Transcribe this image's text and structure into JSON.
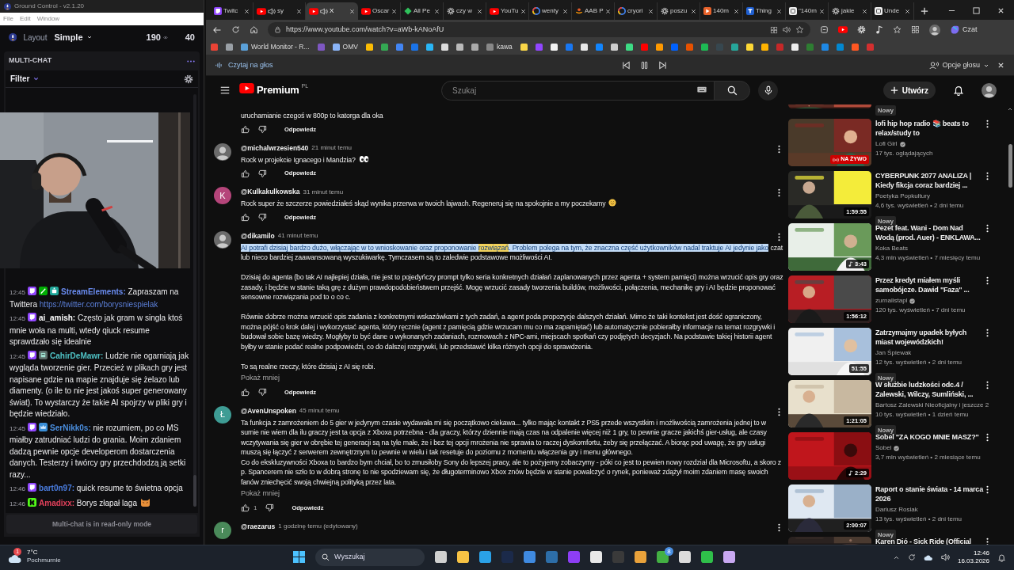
{
  "app": {
    "title": "Ground Control - v2.1.20",
    "menu": [
      "File",
      "Edit",
      "Window"
    ],
    "layout_label": "Layout",
    "layout_value": "Simple",
    "viewers": "190",
    "followers": "40",
    "panel_title": "MULTI-CHAT",
    "filter": "Filter",
    "footer": "Multi-chat is in read-only mode"
  },
  "chat": [
    {
      "time": "12:45",
      "user": "StreamElements:",
      "color": "#6a8cf0",
      "text": "Zapraszam na Twittera",
      "link": "https://twitter.com/borysniespielak"
    },
    {
      "time": "12:45",
      "user": "ai_amish:",
      "color": "#ffffff",
      "text": "Często jak gram w singla ktoś mnie woła na multi, wtedy qiuck resume sprawdzało się idealnie"
    },
    {
      "time": "12:45",
      "user": "CahirDeMawr:",
      "color": "#4fc1c4",
      "text": "Ludzie nie ogarniają jak wygląda tworzenie gier. Przecież w plikach gry jest napisane gdzie na mapie znajduje się żelazo lub diamenty. (o ile to nie jest jakoś super generowany świat). To wystarczy że takie AI spojrzy w pliki gry i będzie wiedziało."
    },
    {
      "time": "12:45",
      "user": "SerNikk0s:",
      "color": "#4b8fe0",
      "text": "nie rozumiem, po co MS miałby zatrudniać ludzi do grania. Moim zdaniem dadzą pewnie opcje developerom dostarczenia danych. Testerzy i twórcy gry przechdodzą ją setki razy..."
    },
    {
      "time": "12:46",
      "user": "bart0n97:",
      "color": "#4a7de0",
      "text": "quick resume to świetna opcja"
    },
    {
      "time": "12:46",
      "user": "Amadixx:",
      "color": "#e0405a",
      "text": "Borys złapał laga",
      "emote": true
    }
  ],
  "browser": {
    "tabs": [
      {
        "title": "Twitc",
        "audio": false,
        "selected": false
      },
      {
        "title": "sy",
        "audio": true,
        "selected": false
      },
      {
        "title": "X",
        "audio": true,
        "selected": true
      },
      {
        "title": "Oscar",
        "audio": false,
        "selected": false
      },
      {
        "title": "All Pe",
        "audio": false,
        "selected": false
      },
      {
        "title": "czy w",
        "audio": false,
        "selected": false
      },
      {
        "title": "YouTu",
        "audio": false,
        "selected": false
      },
      {
        "title": "wenty",
        "audio": false,
        "selected": false
      },
      {
        "title": "AAB P",
        "audio": false,
        "selected": false
      },
      {
        "title": "cryori",
        "audio": false,
        "selected": false
      },
      {
        "title": "poszu",
        "audio": false,
        "selected": false
      },
      {
        "title": "140m",
        "audio": false,
        "selected": false
      },
      {
        "title": "Thing",
        "audio": false,
        "selected": false
      },
      {
        "title": "\"140m",
        "audio": false,
        "selected": false
      },
      {
        "title": "jakie",
        "audio": false,
        "selected": false
      },
      {
        "title": "Unde",
        "audio": false,
        "selected": false
      }
    ],
    "url": "https://www.youtube.com/watch?v=aWb-kANoAfU",
    "copilot": "Czat",
    "bookmarks": [
      {
        "color": "#ea4335"
      },
      {
        "color": "#9aa0a6"
      },
      {
        "label": "World Monitor - R...",
        "color": "#5aa0d8"
      },
      {
        "color": "#7e57c2"
      },
      {
        "label": "OMV",
        "color": "#8ab4f8"
      },
      {
        "color": "#fbbc04"
      },
      {
        "color": "#34a853"
      },
      {
        "color": "#4285f4"
      },
      {
        "color": "#1a73e8"
      },
      {
        "color": "#29b6f6"
      },
      {
        "color": "#dddddd"
      },
      {
        "color": "#bbbbbb"
      },
      {
        "color": "#aaaaaa"
      },
      {
        "label": "kawa",
        "color": "#888888"
      },
      {
        "color": "#f9d648"
      },
      {
        "color": "#9146ff"
      },
      {
        "color": "#f2f2f2"
      },
      {
        "color": "#1877f2"
      },
      {
        "color": "#e8e8e8"
      },
      {
        "color": "#1185fe"
      },
      {
        "color": "#cfcfcf"
      },
      {
        "color": "#3ddc84"
      },
      {
        "color": "#ff0000"
      },
      {
        "color": "#ff9900"
      },
      {
        "color": "#0061fe"
      },
      {
        "color": "#e65100"
      },
      {
        "color": "#1db954"
      },
      {
        "color": "#37474f"
      },
      {
        "color": "#26a69a"
      },
      {
        "color": "#fdd835"
      },
      {
        "color": "#ffb300"
      },
      {
        "color": "#c62828"
      },
      {
        "color": "#eeeeee"
      },
      {
        "color": "#2e7d32"
      },
      {
        "color": "#1e88e5"
      },
      {
        "color": "#0288d1"
      },
      {
        "color": "#ff5722"
      },
      {
        "color": "#d32f2f"
      }
    ],
    "read_aloud": "Czytaj na głos",
    "voice_options": "Opcje głosu"
  },
  "youtube": {
    "logo": "Premium",
    "region": "PL",
    "search_placeholder": "Szukaj",
    "create": "Utwórz",
    "comments": [
      {
        "kind": "partial",
        "segments": [
          {
            "text": "uruchamianie czegoś w 800p to katorga dla oka"
          }
        ],
        "reply": "Odpowiedz"
      },
      {
        "kind": "comment",
        "author": "@michalwrzesien540",
        "time": "21 minut temu",
        "segments": [
          {
            "text": "Rock w projekcie Ignacego i Mandzia?"
          }
        ],
        "reply": "Odpowiedz"
      },
      {
        "kind": "comment",
        "author": "@Kulkakulkowska",
        "time": "31 minut temu",
        "avatar": {
          "letter": "K",
          "color": "#b5457a"
        },
        "segments": [
          {
            "text": "Rock super że szczerze powiedziałeś skąd wynika przerwa w twoich lajwach. Regeneruj się na spokojnie a my poczekamy"
          }
        ],
        "reply": "Odpowiedz"
      },
      {
        "kind": "comment",
        "author": "@dikamilo",
        "time": "41 minut temu",
        "segments": [
          {
            "text": "AI potrafi dzisiaj bardzo dużo, włączając w to wnioskowanie oraz proponowanie ",
            "selected": true,
            "search_match": false
          },
          {
            "text": "rozwiązań",
            "selected": true,
            "search_match": true
          },
          {
            "text": ". Problem polega na tym, że znaczna część użytkowników nadal traktuje AI jedynie jako",
            "selected": true,
            "search_match": false
          },
          {
            "text": " czat lub nieco bardziej zaawansowaną wyszukiwarkę. Tymczasem są to zaledwie podstawowe możliwości AI.\n\nDzisiaj do agenta (bo tak AI najlepiej działa, nie jest to pojedyńczy prompt tylko seria konkretnych działań zaplanowanych przez agenta + system pamięci) można wrzucić opis gry oraz zasady, i będzie w stanie taką grę z dużym prawdopodobieństwem przejść. Mogę wrzucić zasady tworzenia buildów, możliwości, połączenia, mechanikę gry i AI będzie proponować sensowne rozwiązania pod to o co c.\n\nRównie dobrze można wrzucić opis zadania z konkretnymi wskazówkami z tych zadań, a agent poda propozycje dalszych działań. Mimo że taki kontekst jest dość ograniczony, można pójść o krok dalej i wykorzystać agenta, który ręcznie (agent z pamięcią gdzie wrzucam mu co ma zapamiętać) lub automatycznie pobierałby informacje na temat rozgrywki i budował sobie bazę wiedzy. Mogłyby to być dane o wykonanych zadaniach, rozmowach z NPC-ami, miejscach spotkań czy podjętych decyzjach. Na podstawie takiej historii agent byłby w stanie podać realne podpowiedzi, co do dalszej rozgrywki, lub przedstawić kilka różnych opcji do sprawdzenia.\n\nTo są realne rzeczy, które dzisiaj z AI się robi.",
            "selected": false,
            "search_match": false
          }
        ],
        "more": "Pokaż mniej",
        "reply": "Odpowiedz"
      },
      {
        "kind": "comment",
        "author": "@AvenUnspoken",
        "time": "45 minut temu",
        "avatar": {
          "letter": "Ł",
          "color": "#3e9c94"
        },
        "segments": [
          {
            "text": "Ta funkcja z zamrożeniem do 5 gier w jedynym czasie wydawała mi się początkowo ciekawa... tylko mając kontakt z PS5 przede wszystkim i możliwością zamrożenia jednej to w sumie nie wiem dla ilu graczy jest ta opcja z Xboxa potrzebna - dla graczy, którzy dziennie mają czas na odpalenie więcej niż 1 gry, to pewnie gracze jakichś gier-usług, ale czasy wczytywania się gier w obrębie tej generacji są na tyle małe, że i bez tej opcji mrożenia nie sprawia to raczej dyskomfortu, żeby się przełączać. A biorąc pod uwagę, że gry usługi muszą się łączyć z serwerem zewnętrznym to pewnie w wielu i tak resetuje do poziomu z momentu włączenia gry i menu głównego.\nCo do ekskluzywności Xboxa to bardzo bym chciał, bo to zmusiłoby Sony do lepszej pracy, ale to pożyjemy zobaczymy - póki co jest to pewien nowy rozdział dla Microsoftu, a skoro z p. Spancerem nie szło to w dobrą stronę to nie spodziewam się, że długoterminowo Xbox znów będzie w stanie powalczyć o rynek, ponieważ zdążył moim zdaniem masę swoich fanów zniechęcić swoją chwiejną polityką przez lata."
          }
        ],
        "more": "Pokaż mniej",
        "likes": "1",
        "reply": "Odpowiedz"
      },
      {
        "kind": "cut",
        "author": "@raezarus",
        "time": "1 godzinę temu (edytowany)",
        "avatar": {
          "letter": "r",
          "color": "#4a8a5a"
        }
      }
    ],
    "videos": [
      {
        "kind": "partial",
        "badge": "Nowy"
      },
      {
        "kind": "live",
        "title": "lofi hip hop radio 📚 beats to relax/study to",
        "channel": "Lofi Girl",
        "verified": true,
        "meta": "17 tys. oglądających",
        "live_label": "NA ŻYWO"
      },
      {
        "kind": "video",
        "title": "CYBERPUNK 2077 ANALIZA | Kiedy fikcja coraz bardziej ...",
        "channel": "Poetyka Popkultury",
        "meta": "4,6 tys. wyświetleń • 2 dni temu",
        "duration": "1:59:55",
        "badge": "Nowy"
      },
      {
        "kind": "video",
        "title": "Pezet feat. Wani - Dom  Nad Wodą (prod. Auer) - ENKLAWA...",
        "channel": "Koka Beats",
        "meta": "4,3 mln wyświetleń • 7 miesięcy temu",
        "duration": "3:43",
        "music": true
      },
      {
        "kind": "video",
        "title": "Przez kredyt miałem myśli samobójcze. Dawid \"Faza\" ...",
        "channel": "zurnalistapl",
        "verified": true,
        "meta": "120 tys. wyświetleń • 7 dni temu",
        "duration": "1:56:12"
      },
      {
        "kind": "video",
        "title": "Zatrzymajmy upadek byłych miast wojewódzkich!",
        "channel": "Jan Śpiewak",
        "meta": "12 tys. wyświetleń • 2 dni temu",
        "duration": "51:55",
        "badge": "Nowy"
      },
      {
        "kind": "video",
        "title": "W służbie ludzkości odc.4 / Zalewski, Wilczy, Sumliński, ...",
        "channel": "Bartosz Zalewski Nieoficjalny i jeszcze 2",
        "meta": "10 tys. wyświetleń • 1 dzień temu",
        "duration": "1:21:05",
        "badge": "Nowy"
      },
      {
        "kind": "video",
        "title": "Sobel \"ZA KOGO MNIE MASZ?\"",
        "channel": "Sobel",
        "verified": true,
        "meta": "3,7 mln wyświetleń • 2 miesiące temu",
        "duration": "2:29",
        "music": true
      },
      {
        "kind": "video",
        "title": "Raport o stanie świata - 14 marca 2026",
        "channel": "Dariusz Rosiak",
        "meta": "13 tys. wyświetleń • 2 dni temu",
        "duration": "2:00:07",
        "badge": "Nowy"
      },
      {
        "kind": "cut",
        "title": "Karen Dió - Sick Ride (Official"
      }
    ]
  },
  "taskbar": {
    "weather_badge": "1",
    "temperature": "7°C",
    "weather": "Pochmurnie",
    "search": "Wyszukaj",
    "badge": "8",
    "time": "12:46",
    "date": "16.03.2026"
  }
}
